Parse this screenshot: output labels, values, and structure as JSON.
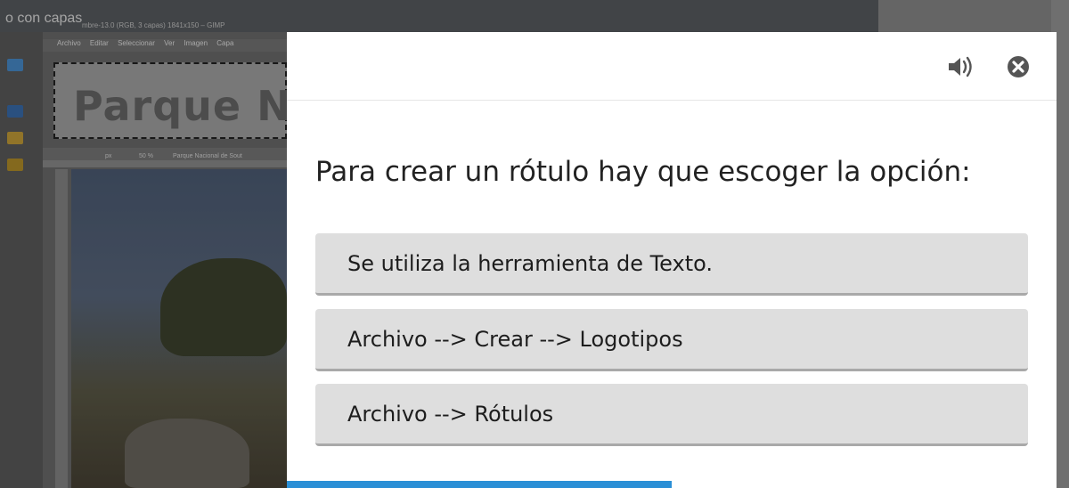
{
  "background": {
    "caption": "o con capas",
    "gimp_title": "mbre-13.0 (RGB, 3 capas) 1841x150 – GIMP",
    "gimp_menu": [
      "Archivo",
      "Editar",
      "Seleccionar",
      "Ver",
      "Imagen",
      "Capa"
    ],
    "canvas_text": "Parque Nac",
    "status_unit": "px",
    "status_zoom": "50 %",
    "status_layer": "Parque Nacional de Sout"
  },
  "dialog": {
    "speaker_icon": "speaker-icon",
    "close_icon": "close-icon",
    "question": "Para crear un rótulo hay que escoger la opción:",
    "options": [
      {
        "label": "Se utiliza la herramienta de Texto."
      },
      {
        "label": "Archivo --> Crear --> Logotipos"
      },
      {
        "label": "Archivo --> Rótulos"
      }
    ],
    "progress_fraction": 0.5,
    "colors": {
      "progress": "#2a8fd6",
      "option_bg": "#dedede",
      "icon": "#555555"
    }
  }
}
